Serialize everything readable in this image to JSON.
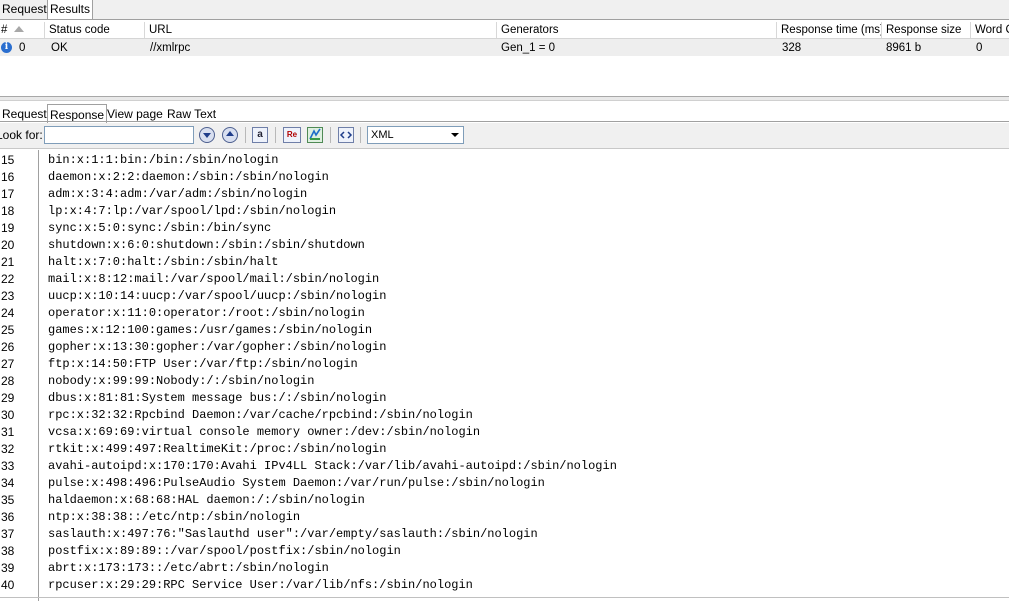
{
  "top_tabs": [
    "Request",
    "Results"
  ],
  "table": {
    "headers": [
      "#",
      "Status code",
      "URL",
      "Generators",
      "Response time (ms)",
      "Response size",
      "Word C"
    ],
    "row": {
      "icon": "info-icon",
      "cells": [
        "0",
        "OK",
        "//xmlrpc",
        "Gen_1 = 0",
        "328",
        "8961 b",
        "0"
      ]
    }
  },
  "view_tabs": [
    "Request",
    "Response",
    "View page",
    "Raw Text"
  ],
  "toolbar": {
    "look_for_label": "Look for:",
    "look_for_value": "",
    "icons": [
      "search-down-icon",
      "search-up-icon",
      "match-case-icon",
      "regex-icon",
      "highlight-icon",
      "wrap-icon"
    ],
    "match_case_label": "a",
    "regex_label": "Re",
    "format_selected": "XML"
  },
  "code_lines": [
    {
      "n": "15",
      "text": "bin:x:1:1:bin:/bin:/sbin/nologin"
    },
    {
      "n": "16",
      "text": "daemon:x:2:2:daemon:/sbin:/sbin/nologin"
    },
    {
      "n": "17",
      "text": "adm:x:3:4:adm:/var/adm:/sbin/nologin"
    },
    {
      "n": "18",
      "text": "lp:x:4:7:lp:/var/spool/lpd:/sbin/nologin"
    },
    {
      "n": "19",
      "text": "sync:x:5:0:sync:/sbin:/bin/sync"
    },
    {
      "n": "20",
      "text": "shutdown:x:6:0:shutdown:/sbin:/sbin/shutdown"
    },
    {
      "n": "21",
      "text": "halt:x:7:0:halt:/sbin:/sbin/halt"
    },
    {
      "n": "22",
      "text": "mail:x:8:12:mail:/var/spool/mail:/sbin/nologin"
    },
    {
      "n": "23",
      "text": "uucp:x:10:14:uucp:/var/spool/uucp:/sbin/nologin"
    },
    {
      "n": "24",
      "text": "operator:x:11:0:operator:/root:/sbin/nologin"
    },
    {
      "n": "25",
      "text": "games:x:12:100:games:/usr/games:/sbin/nologin"
    },
    {
      "n": "26",
      "text": "gopher:x:13:30:gopher:/var/gopher:/sbin/nologin"
    },
    {
      "n": "27",
      "text": "ftp:x:14:50:FTP User:/var/ftp:/sbin/nologin"
    },
    {
      "n": "28",
      "text": "nobody:x:99:99:Nobody:/:/sbin/nologin"
    },
    {
      "n": "29",
      "text": "dbus:x:81:81:System message bus:/:/sbin/nologin"
    },
    {
      "n": "30",
      "text": "rpc:x:32:32:Rpcbind Daemon:/var/cache/rpcbind:/sbin/nologin"
    },
    {
      "n": "31",
      "text": "vcsa:x:69:69:virtual console memory owner:/dev:/sbin/nologin"
    },
    {
      "n": "32",
      "text": "rtkit:x:499:497:RealtimeKit:/proc:/sbin/nologin"
    },
    {
      "n": "33",
      "text": "avahi-autoipd:x:170:170:Avahi IPv4LL Stack:/var/lib/avahi-autoipd:/sbin/nologin"
    },
    {
      "n": "34",
      "text": "pulse:x:498:496:PulseAudio System Daemon:/var/run/pulse:/sbin/nologin"
    },
    {
      "n": "35",
      "text": "haldaemon:x:68:68:HAL daemon:/:/sbin/nologin"
    },
    {
      "n": "36",
      "text": "ntp:x:38:38::/etc/ntp:/sbin/nologin"
    },
    {
      "n": "37",
      "text": "saslauth:x:497:76:\"Saslauthd user\":/var/empty/saslauth:/sbin/nologin"
    },
    {
      "n": "38",
      "text": "postfix:x:89:89::/var/spool/postfix:/sbin/nologin"
    },
    {
      "n": "39",
      "text": "abrt:x:173:173::/etc/abrt:/sbin/nologin"
    },
    {
      "n": "40",
      "text": "rpcuser:x:29:29:RPC Service User:/var/lib/nfs:/sbin/nologin"
    }
  ]
}
